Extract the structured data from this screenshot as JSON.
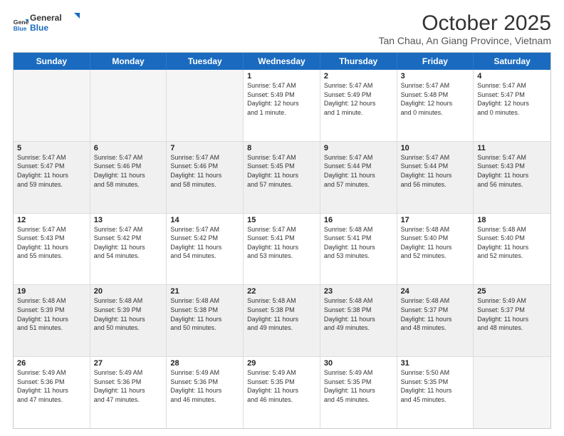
{
  "logo": {
    "line1": "General",
    "line2": "Blue"
  },
  "title": "October 2025",
  "subtitle": "Tan Chau, An Giang Province, Vietnam",
  "days": [
    "Sunday",
    "Monday",
    "Tuesday",
    "Wednesday",
    "Thursday",
    "Friday",
    "Saturday"
  ],
  "weeks": [
    [
      {
        "day": "",
        "lines": [],
        "empty": true
      },
      {
        "day": "",
        "lines": [],
        "empty": true
      },
      {
        "day": "",
        "lines": [],
        "empty": true
      },
      {
        "day": "1",
        "lines": [
          "Sunrise: 5:47 AM",
          "Sunset: 5:49 PM",
          "Daylight: 12 hours",
          "and 1 minute."
        ],
        "empty": false
      },
      {
        "day": "2",
        "lines": [
          "Sunrise: 5:47 AM",
          "Sunset: 5:49 PM",
          "Daylight: 12 hours",
          "and 1 minute."
        ],
        "empty": false
      },
      {
        "day": "3",
        "lines": [
          "Sunrise: 5:47 AM",
          "Sunset: 5:48 PM",
          "Daylight: 12 hours",
          "and 0 minutes."
        ],
        "empty": false
      },
      {
        "day": "4",
        "lines": [
          "Sunrise: 5:47 AM",
          "Sunset: 5:47 PM",
          "Daylight: 12 hours",
          "and 0 minutes."
        ],
        "empty": false
      }
    ],
    [
      {
        "day": "5",
        "lines": [
          "Sunrise: 5:47 AM",
          "Sunset: 5:47 PM",
          "Daylight: 11 hours",
          "and 59 minutes."
        ],
        "empty": false,
        "shaded": true
      },
      {
        "day": "6",
        "lines": [
          "Sunrise: 5:47 AM",
          "Sunset: 5:46 PM",
          "Daylight: 11 hours",
          "and 58 minutes."
        ],
        "empty": false,
        "shaded": true
      },
      {
        "day": "7",
        "lines": [
          "Sunrise: 5:47 AM",
          "Sunset: 5:46 PM",
          "Daylight: 11 hours",
          "and 58 minutes."
        ],
        "empty": false,
        "shaded": true
      },
      {
        "day": "8",
        "lines": [
          "Sunrise: 5:47 AM",
          "Sunset: 5:45 PM",
          "Daylight: 11 hours",
          "and 57 minutes."
        ],
        "empty": false,
        "shaded": true
      },
      {
        "day": "9",
        "lines": [
          "Sunrise: 5:47 AM",
          "Sunset: 5:44 PM",
          "Daylight: 11 hours",
          "and 57 minutes."
        ],
        "empty": false,
        "shaded": true
      },
      {
        "day": "10",
        "lines": [
          "Sunrise: 5:47 AM",
          "Sunset: 5:44 PM",
          "Daylight: 11 hours",
          "and 56 minutes."
        ],
        "empty": false,
        "shaded": true
      },
      {
        "day": "11",
        "lines": [
          "Sunrise: 5:47 AM",
          "Sunset: 5:43 PM",
          "Daylight: 11 hours",
          "and 56 minutes."
        ],
        "empty": false,
        "shaded": true
      }
    ],
    [
      {
        "day": "12",
        "lines": [
          "Sunrise: 5:47 AM",
          "Sunset: 5:43 PM",
          "Daylight: 11 hours",
          "and 55 minutes."
        ],
        "empty": false
      },
      {
        "day": "13",
        "lines": [
          "Sunrise: 5:47 AM",
          "Sunset: 5:42 PM",
          "Daylight: 11 hours",
          "and 54 minutes."
        ],
        "empty": false
      },
      {
        "day": "14",
        "lines": [
          "Sunrise: 5:47 AM",
          "Sunset: 5:42 PM",
          "Daylight: 11 hours",
          "and 54 minutes."
        ],
        "empty": false
      },
      {
        "day": "15",
        "lines": [
          "Sunrise: 5:47 AM",
          "Sunset: 5:41 PM",
          "Daylight: 11 hours",
          "and 53 minutes."
        ],
        "empty": false
      },
      {
        "day": "16",
        "lines": [
          "Sunrise: 5:48 AM",
          "Sunset: 5:41 PM",
          "Daylight: 11 hours",
          "and 53 minutes."
        ],
        "empty": false
      },
      {
        "day": "17",
        "lines": [
          "Sunrise: 5:48 AM",
          "Sunset: 5:40 PM",
          "Daylight: 11 hours",
          "and 52 minutes."
        ],
        "empty": false
      },
      {
        "day": "18",
        "lines": [
          "Sunrise: 5:48 AM",
          "Sunset: 5:40 PM",
          "Daylight: 11 hours",
          "and 52 minutes."
        ],
        "empty": false
      }
    ],
    [
      {
        "day": "19",
        "lines": [
          "Sunrise: 5:48 AM",
          "Sunset: 5:39 PM",
          "Daylight: 11 hours",
          "and 51 minutes."
        ],
        "empty": false,
        "shaded": true
      },
      {
        "day": "20",
        "lines": [
          "Sunrise: 5:48 AM",
          "Sunset: 5:39 PM",
          "Daylight: 11 hours",
          "and 50 minutes."
        ],
        "empty": false,
        "shaded": true
      },
      {
        "day": "21",
        "lines": [
          "Sunrise: 5:48 AM",
          "Sunset: 5:38 PM",
          "Daylight: 11 hours",
          "and 50 minutes."
        ],
        "empty": false,
        "shaded": true
      },
      {
        "day": "22",
        "lines": [
          "Sunrise: 5:48 AM",
          "Sunset: 5:38 PM",
          "Daylight: 11 hours",
          "and 49 minutes."
        ],
        "empty": false,
        "shaded": true
      },
      {
        "day": "23",
        "lines": [
          "Sunrise: 5:48 AM",
          "Sunset: 5:38 PM",
          "Daylight: 11 hours",
          "and 49 minutes."
        ],
        "empty": false,
        "shaded": true
      },
      {
        "day": "24",
        "lines": [
          "Sunrise: 5:48 AM",
          "Sunset: 5:37 PM",
          "Daylight: 11 hours",
          "and 48 minutes."
        ],
        "empty": false,
        "shaded": true
      },
      {
        "day": "25",
        "lines": [
          "Sunrise: 5:49 AM",
          "Sunset: 5:37 PM",
          "Daylight: 11 hours",
          "and 48 minutes."
        ],
        "empty": false,
        "shaded": true
      }
    ],
    [
      {
        "day": "26",
        "lines": [
          "Sunrise: 5:49 AM",
          "Sunset: 5:36 PM",
          "Daylight: 11 hours",
          "and 47 minutes."
        ],
        "empty": false
      },
      {
        "day": "27",
        "lines": [
          "Sunrise: 5:49 AM",
          "Sunset: 5:36 PM",
          "Daylight: 11 hours",
          "and 47 minutes."
        ],
        "empty": false
      },
      {
        "day": "28",
        "lines": [
          "Sunrise: 5:49 AM",
          "Sunset: 5:36 PM",
          "Daylight: 11 hours",
          "and 46 minutes."
        ],
        "empty": false
      },
      {
        "day": "29",
        "lines": [
          "Sunrise: 5:49 AM",
          "Sunset: 5:35 PM",
          "Daylight: 11 hours",
          "and 46 minutes."
        ],
        "empty": false
      },
      {
        "day": "30",
        "lines": [
          "Sunrise: 5:49 AM",
          "Sunset: 5:35 PM",
          "Daylight: 11 hours",
          "and 45 minutes."
        ],
        "empty": false
      },
      {
        "day": "31",
        "lines": [
          "Sunrise: 5:50 AM",
          "Sunset: 5:35 PM",
          "Daylight: 11 hours",
          "and 45 minutes."
        ],
        "empty": false
      },
      {
        "day": "",
        "lines": [],
        "empty": true
      }
    ]
  ]
}
